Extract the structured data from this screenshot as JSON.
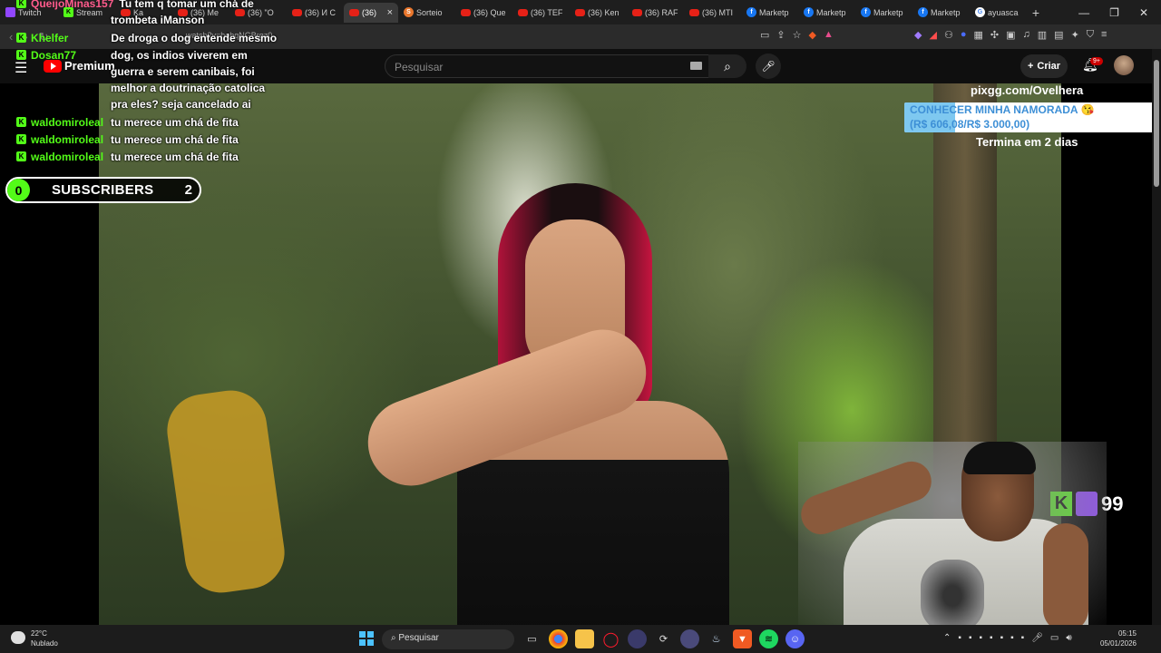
{
  "browser": {
    "tabs": [
      {
        "label": "Twitch",
        "icon": "twitch-icon"
      },
      {
        "label": "Stream",
        "icon": "kick-icon"
      },
      {
        "label": "Ka",
        "icon": "youtube-icon"
      },
      {
        "label": "(36) Me",
        "icon": "youtube-icon"
      },
      {
        "label": "(36) \"O",
        "icon": "youtube-icon"
      },
      {
        "label": "(36) И С",
        "icon": "youtube-icon"
      },
      {
        "label": "(36)",
        "icon": "youtube-icon",
        "active": true
      },
      {
        "label": "Sorteio",
        "icon": "s-icon"
      },
      {
        "label": "(36) Que",
        "icon": "youtube-icon"
      },
      {
        "label": "(36) TEF",
        "icon": "youtube-icon"
      },
      {
        "label": "(36) Ken",
        "icon": "youtube-icon"
      },
      {
        "label": "(36) RAF",
        "icon": "youtube-icon"
      },
      {
        "label": "(36) MTI",
        "icon": "youtube-icon"
      },
      {
        "label": "Marketp",
        "icon": "facebook-icon"
      },
      {
        "label": "Marketp",
        "icon": "facebook-icon"
      },
      {
        "label": "Marketp",
        "icon": "facebook-icon"
      },
      {
        "label": "Marketp",
        "icon": "facebook-icon"
      },
      {
        "label": "ayuasca",
        "icon": "google-icon"
      }
    ],
    "url": "watch?v=hobqNGBrgz0"
  },
  "youtube": {
    "logo_text": "Premium",
    "search_placeholder": "Pesquisar",
    "create_label": "Criar",
    "notif_badge": "9+"
  },
  "chat": [
    {
      "user": "QueijoMinas157",
      "msg": "Tu tem q tomar um chá de",
      "color": "pink"
    },
    {
      "user": "",
      "msg": "trombeta iManson"
    },
    {
      "user": "Khelfer",
      "msg": "De droga o dog entende mesmo"
    },
    {
      "user": "Dosan77",
      "msg": "dog, os indios viverem em"
    },
    {
      "user": "",
      "msg": "guerra e serem canibais, foi"
    },
    {
      "user": "",
      "msg": "melhor a doutrinação catolica"
    },
    {
      "user": "",
      "msg": "pra eles? seja cancelado ai"
    },
    {
      "user": "waldomiroleal",
      "msg": "tu merece um chá de fita"
    },
    {
      "user": "waldomiroleal",
      "msg": "tu merece um chá de fita"
    },
    {
      "user": "waldomiroleal",
      "msg": "tu merece um chá de fita"
    }
  ],
  "subs": {
    "left": "0",
    "label": "SUBSCRIBERS",
    "right": "2"
  },
  "goal": {
    "site": "pixgg.com/Ovelhera",
    "title": "CONHECER MINHA NAMORADA 😘",
    "amount": "(R$ 606,08/R$ 3.000,00)",
    "progress": 0.202,
    "ends": "Termina em 2 dias"
  },
  "viewers": {
    "count": "99"
  },
  "taskbar": {
    "weather_temp": "22°C",
    "weather_desc": "Nublado",
    "weather_badge": "2",
    "search_label": "Pesquisar",
    "time": "05:15",
    "date": "05/01/2026"
  }
}
